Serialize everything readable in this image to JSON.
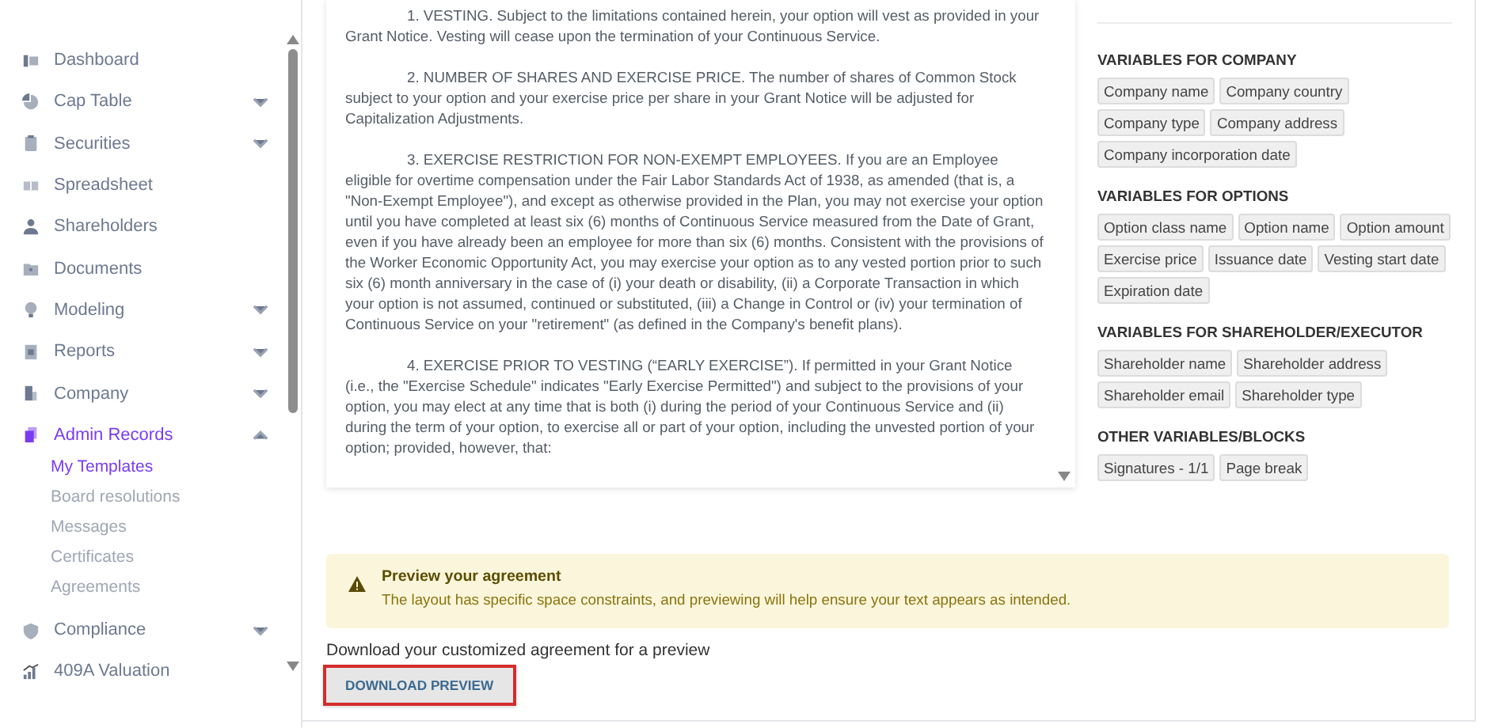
{
  "sidebar": {
    "items": [
      {
        "label": "Dashboard",
        "selected": false
      },
      {
        "label": "Cap Table",
        "selected": false,
        "expanded": false
      },
      {
        "label": "Securities",
        "selected": false,
        "expanded": false
      },
      {
        "label": "Spreadsheet",
        "selected": false
      },
      {
        "label": "Shareholders",
        "selected": false
      },
      {
        "label": "Documents",
        "selected": false
      },
      {
        "label": "Modeling",
        "selected": false,
        "expanded": false
      },
      {
        "label": "Reports",
        "selected": false,
        "expanded": false
      },
      {
        "label": "Company",
        "selected": false,
        "expanded": false
      },
      {
        "label": "Admin Records",
        "selected": true,
        "expanded": true,
        "children": [
          {
            "label": "My Templates",
            "selected": true
          },
          {
            "label": "Board resolutions",
            "selected": false
          },
          {
            "label": "Messages",
            "selected": false
          },
          {
            "label": "Certificates",
            "selected": false
          },
          {
            "label": "Agreements",
            "selected": false
          }
        ]
      },
      {
        "label": "Compliance",
        "selected": false,
        "expanded": false
      },
      {
        "label": "409A Valuation",
        "selected": false
      }
    ]
  },
  "document": {
    "paragraphs": [
      "1. VESTING. Subject to the limitations contained herein, your option will vest as provided in your Grant Notice. Vesting will cease upon the termination of your Continuous Service.",
      "2. NUMBER OF SHARES AND EXERCISE PRICE. The number of shares of Common Stock subject to your option and your exercise price per share in your Grant Notice will be adjusted for Capitalization Adjustments.",
      "3. EXERCISE RESTRICTION FOR NON-EXEMPT EMPLOYEES. If you are an Employee eligible for overtime compensation under the Fair Labor Standards Act of 1938, as amended (that is, a \"Non-Exempt Employee\"), and except as otherwise provided in the Plan, you may not exercise your option until you have completed at least six (6) months of Continuous Service measured from the Date of Grant, even if you have already been an employee for more than six (6) months. Consistent with the provisions of the Worker Economic Opportunity Act, you may exercise your option as to any vested portion prior to such six (6) month anniversary in the case of (i) your death or disability, (ii) a Corporate Transaction in which your option is not assumed, continued or substituted, (iii) a Change in Control or (iv) your termination of Continuous Service on your \"retirement\" (as defined in the Company's benefit plans).",
      "4. EXERCISE PRIOR TO VESTING (“EARLY EXERCISE”). If permitted in your Grant Notice (i.e., the \"Exercise Schedule\" indicates \"Early Exercise Permitted\") and subject to the provisions of your option, you may elect at any time that is both (i) during the period of your Continuous Service and (ii) during the term of your option, to exercise all or part of your option, including the unvested portion of your option; provided, however, that:"
    ]
  },
  "variables": {
    "groups": [
      {
        "heading": "VARIABLES FOR COMPANY",
        "chips": [
          "Company name",
          "Company country",
          "Company type",
          "Company address",
          "Company incorporation date"
        ]
      },
      {
        "heading": "VARIABLES FOR OPTIONS",
        "chips": [
          "Option class name",
          "Option name",
          "Option amount",
          "Exercise price",
          "Issuance date",
          "Vesting start date",
          "Expiration date"
        ]
      },
      {
        "heading": "VARIABLES FOR SHAREHOLDER/EXECUTOR",
        "chips": [
          "Shareholder name",
          "Shareholder address",
          "Shareholder email",
          "Shareholder type"
        ]
      },
      {
        "heading": "OTHER VARIABLES/BLOCKS",
        "chips": [
          "Signatures - 1/1",
          "Page break"
        ]
      }
    ]
  },
  "notice": {
    "title": "Preview your agreement",
    "message": "The layout has specific space constraints, and previewing will help ensure your text appears as intended."
  },
  "download": {
    "label": "Download your customized agreement for a preview",
    "button": "DOWNLOAD PREVIEW"
  }
}
